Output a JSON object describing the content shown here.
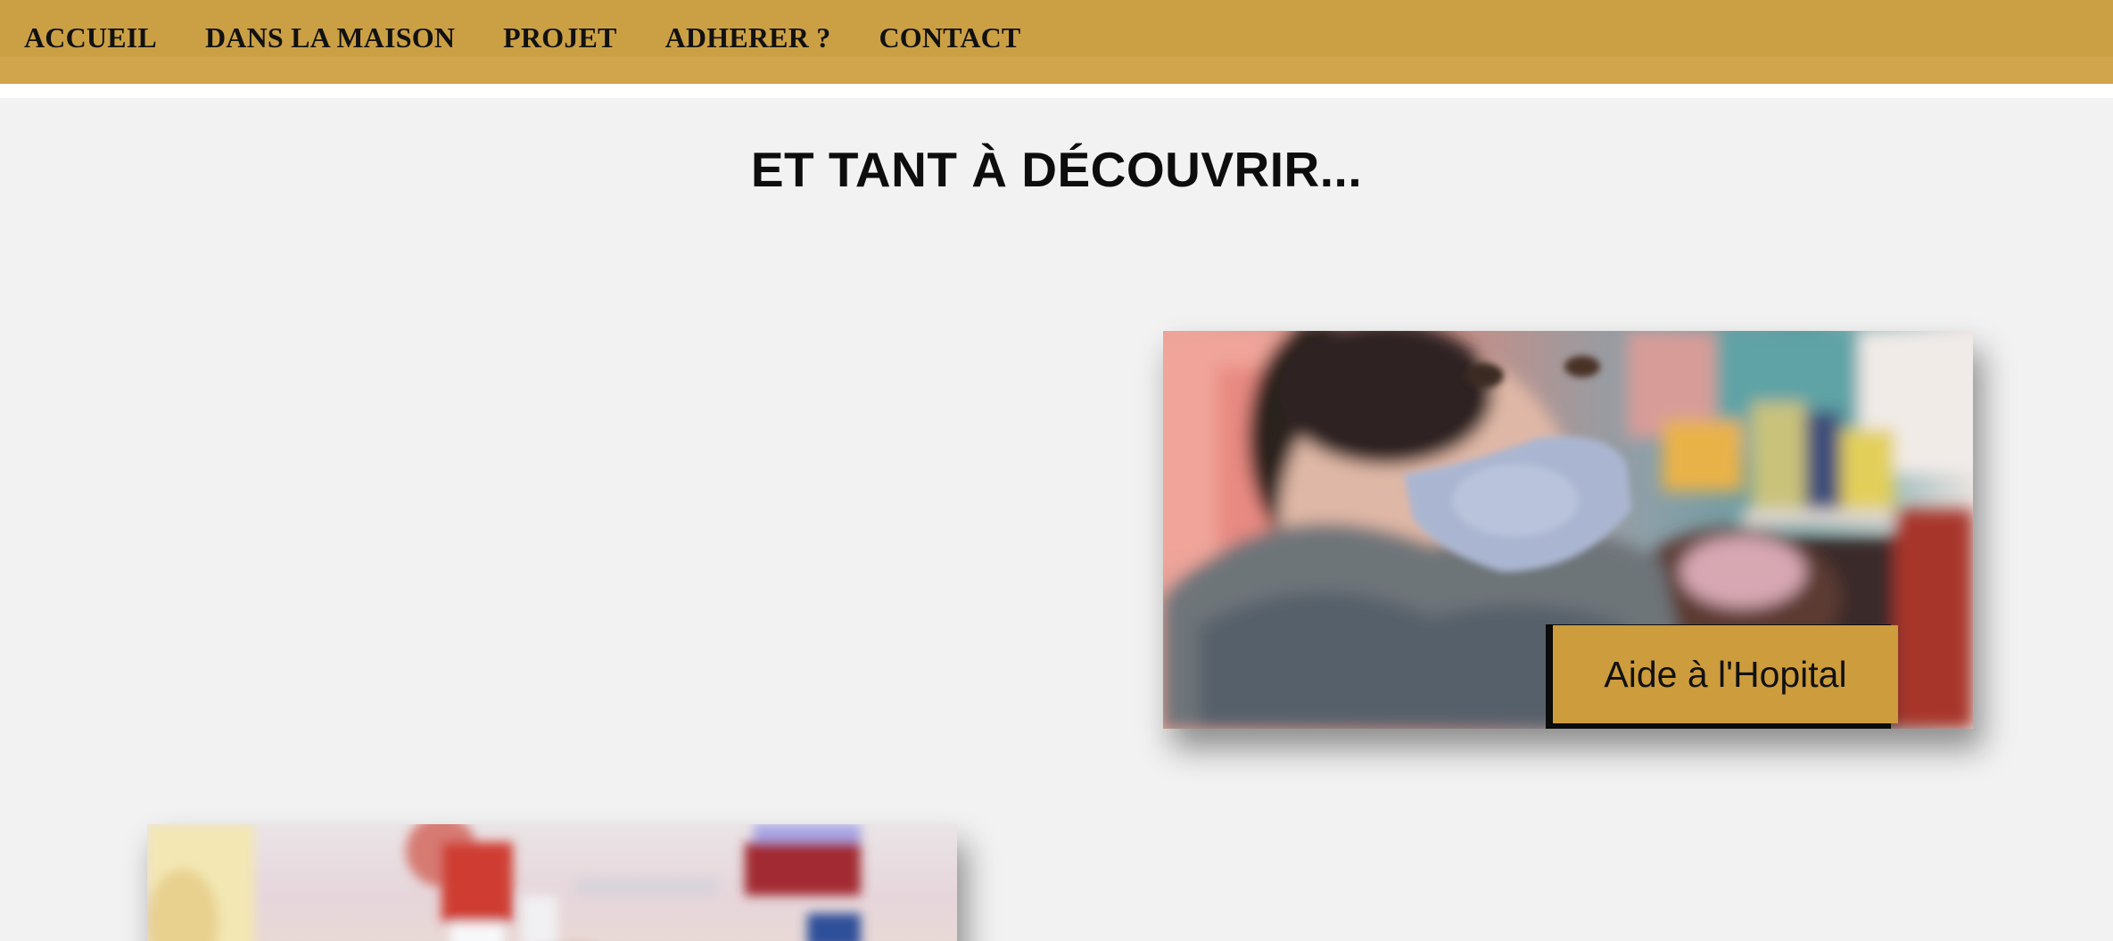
{
  "nav": {
    "items": [
      {
        "label": "ACCUEIL"
      },
      {
        "label": "DANS LA MAISON"
      },
      {
        "label": "PROJET"
      },
      {
        "label": "ADHERER ?"
      },
      {
        "label": "CONTACT"
      }
    ]
  },
  "section": {
    "title": "ET TANT À DÉCOUVRIR..."
  },
  "cards": [
    {
      "label": "Aide à l'Hopital"
    }
  ],
  "colors": {
    "nav_background": "#cba045",
    "page_background": "#f2f2f2",
    "label_background": "#cd9c3d",
    "label_shadow": "#0b0b0b",
    "text": "#111111"
  }
}
